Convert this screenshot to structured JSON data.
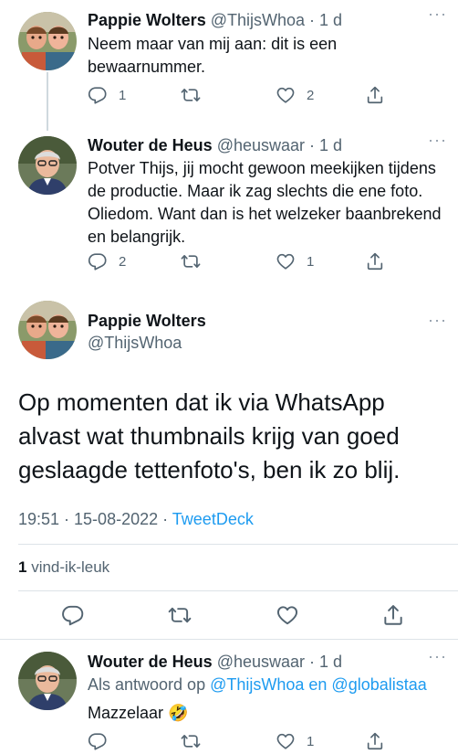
{
  "tweets": [
    {
      "name": "Pappie Wolters",
      "handle": "@ThijsWhoa",
      "time": "· 1 d",
      "text": "Neem maar van mij aan: dit is een bewaarnummer.",
      "replies": "1",
      "retweets": "",
      "likes": "2"
    },
    {
      "name": "Wouter de Heus",
      "handle": "@heuswaar",
      "time": "· 1 d",
      "text": "Potver Thijs, jij mocht gewoon meekijken tijdens de productie. Maar ik zag slechts die ene foto. Oliedom. Want dan is het welzeker baanbrekend en belangrijk.",
      "replies": "2",
      "retweets": "",
      "likes": "1"
    }
  ],
  "main_tweet": {
    "name": "Pappie Wolters",
    "handle": "@ThijsWhoa",
    "text": "Op momenten dat ik via WhatsApp alvast wat thumbnails krijg van goed geslaagde tettenfoto's, ben ik zo blij.",
    "datetime": "19:51 · 15-08-2022 ·",
    "source": "TweetDeck",
    "likes_count": "1",
    "likes_label": "vind-ik-leuk"
  },
  "reply": {
    "name": "Wouter de Heus",
    "handle": "@heuswaar",
    "time": "· 1 d",
    "reply_prefix": "Als antwoord op",
    "reply_to": "@ThijsWhoa en @globalistaa",
    "text": "Mazzelaar 🤣",
    "replies": "",
    "retweets": "",
    "likes": "1"
  },
  "icons": {
    "reply": "reply-icon",
    "retweet": "retweet-icon",
    "like": "heart-icon",
    "share": "share-icon",
    "more": "more-icon"
  },
  "colors": {
    "text": "#0f1419",
    "secondary": "#536471",
    "accent": "#1d9bf0",
    "divider": "#dde3e8"
  }
}
